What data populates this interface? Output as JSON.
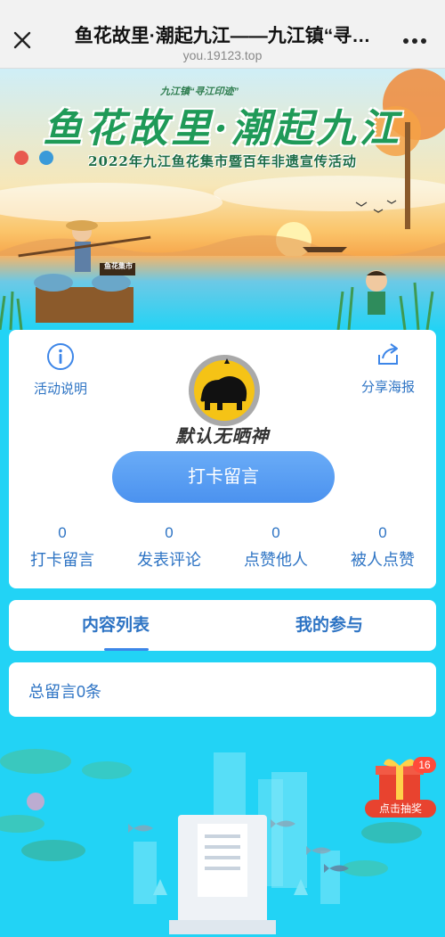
{
  "navbar": {
    "title": "鱼花故里·潮起九江——九江镇“寻…",
    "url": "you.19123.top"
  },
  "banner": {
    "title": "鱼花故里·潮起九江",
    "subtitle": "2022年九江鱼花集市暨百年非遗宣传活动",
    "slogan": "九江镇“寻江印迹”",
    "sign": "鱼花集市"
  },
  "user": {
    "nickname": "默认无晒神",
    "left_action": "活动说明",
    "right_action": "分享海报",
    "checkin_button": "打卡留言",
    "stats": [
      {
        "value": "0",
        "label": "打卡留言"
      },
      {
        "value": "0",
        "label": "发表评论"
      },
      {
        "value": "0",
        "label": "点赞他人"
      },
      {
        "value": "0",
        "label": "被人点赞"
      }
    ]
  },
  "tabs": [
    {
      "label": "内容列表",
      "active": true
    },
    {
      "label": "我的参与",
      "active": false
    }
  ],
  "total": "总留言0条",
  "lottery": {
    "label": "点击抽奖",
    "badge": "16"
  },
  "colors": {
    "primary_blue": "#4b92ef",
    "text_blue": "#2e74c4",
    "background": "#22d3f5",
    "lottery_red": "#e8432f"
  }
}
